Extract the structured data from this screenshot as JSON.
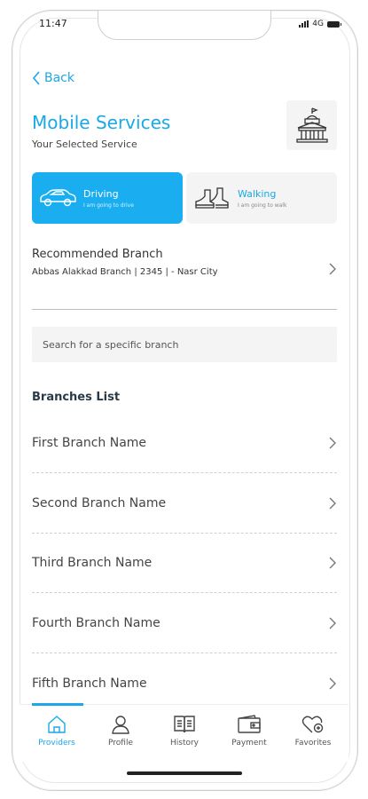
{
  "status": {
    "time": "11:47",
    "network": "4G"
  },
  "nav": {
    "back_label": "Back"
  },
  "header": {
    "title": "Mobile Services",
    "subtitle": "Your Selected Service",
    "icon": "government-building-icon"
  },
  "modes": [
    {
      "label": "Driving",
      "sub": "I am going to drive",
      "icon": "car-icon",
      "selected": true
    },
    {
      "label": "Walking",
      "sub": "I am going to walk",
      "icon": "shoes-icon",
      "selected": false
    }
  ],
  "recommended": {
    "label": "Recommended Branch",
    "value": "Abbas Alakkad Branch | 2345 | - Nasr City"
  },
  "search": {
    "placeholder": "Search for a specific branch"
  },
  "branches": {
    "heading": "Branches List",
    "items": [
      {
        "name": "First Branch Name"
      },
      {
        "name": "Second Branch Name"
      },
      {
        "name": "Third Branch Name"
      },
      {
        "name": "Fourth Branch Name"
      },
      {
        "name": "Fifth Branch Name"
      }
    ]
  },
  "tabbar": {
    "active": "Providers",
    "items": [
      {
        "label": "Providers",
        "icon": "home-icon"
      },
      {
        "label": "Profile",
        "icon": "profile-icon"
      },
      {
        "label": "History",
        "icon": "book-icon"
      },
      {
        "label": "Payment",
        "icon": "wallet-icon"
      },
      {
        "label": "Favorites",
        "icon": "heart-icon"
      }
    ]
  },
  "colors": {
    "accent": "#1aa8e6",
    "driving_bg": "#1aaef0",
    "panel_bg": "#f4f4f4"
  }
}
